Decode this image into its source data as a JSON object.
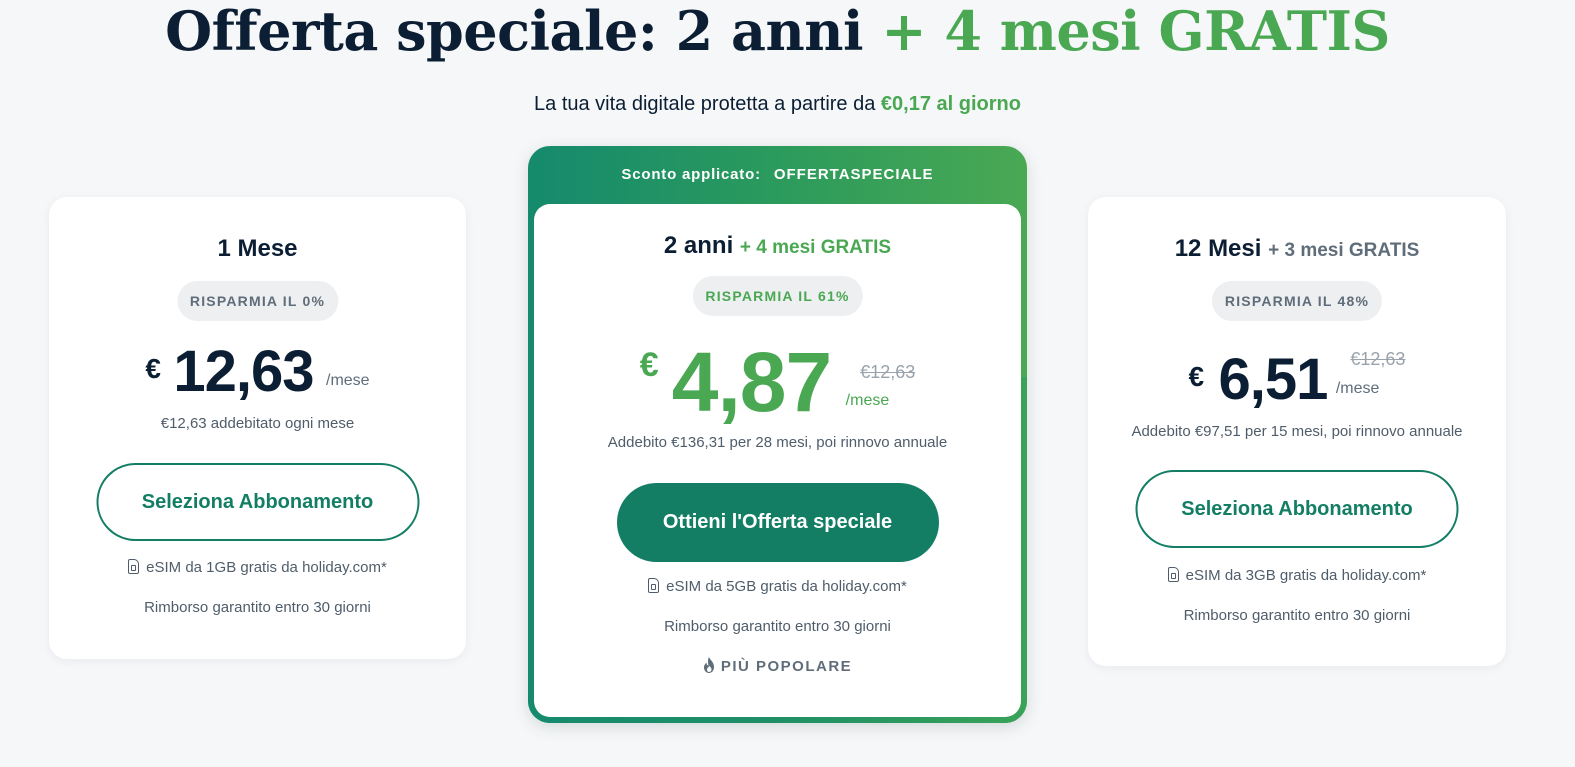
{
  "header": {
    "title_main": "Offerta speciale: 2 anni",
    "title_highlight": "+ 4 mesi GRATIS",
    "subtitle_main": "La tua vita digitale protetta a partire da",
    "subtitle_highlight": "€0,17 al giorno"
  },
  "plans": [
    {
      "title": "1 Mese",
      "title_extra": "",
      "savings": "RISPARMIA IL 0%",
      "currency": "€",
      "price": "12,63",
      "per": "/mese",
      "old_price": "",
      "billing": "€12,63 addebitato ogni mese",
      "button": "Seleziona Abbonamento",
      "esim": "eSIM da 1GB gratis da holiday.com*",
      "refund": "Rimborso garantito entro 30 giorni"
    },
    {
      "discount_label": "Sconto applicato:",
      "discount_code": "OFFERTASPECIALE",
      "title": "2 anni",
      "title_extra": "+ 4 mesi GRATIS",
      "savings": "RISPARMIA IL 61%",
      "currency": "€",
      "price": "4,87",
      "per": "/mese",
      "old_price": "€12,63",
      "billing": "Addebito €136,31 per 28 mesi, poi rinnovo annuale",
      "button": "Ottieni l'Offerta speciale",
      "esim": "eSIM da 5GB gratis da holiday.com*",
      "refund": "Rimborso garantito entro 30 giorni",
      "popular": "PIÙ POPOLARE"
    },
    {
      "title": "12 Mesi",
      "title_extra": "+ 3 mesi GRATIS",
      "savings": "RISPARMIA IL 48%",
      "currency": "€",
      "price": "6,51",
      "per": "/mese",
      "old_price": "€12,63",
      "billing": "Addebito €97,51 per 15 mesi, poi rinnovo annuale",
      "button": "Seleziona Abbonamento",
      "esim": "eSIM da 3GB gratis da holiday.com*",
      "refund": "Rimborso garantito entro 30 giorni"
    }
  ],
  "icons": {
    "esim": "sim-card-icon",
    "popular": "flame-icon"
  },
  "colors": {
    "brand_green": "#137e64",
    "highlight_green": "#4aa853",
    "navy": "#0b1e33"
  }
}
